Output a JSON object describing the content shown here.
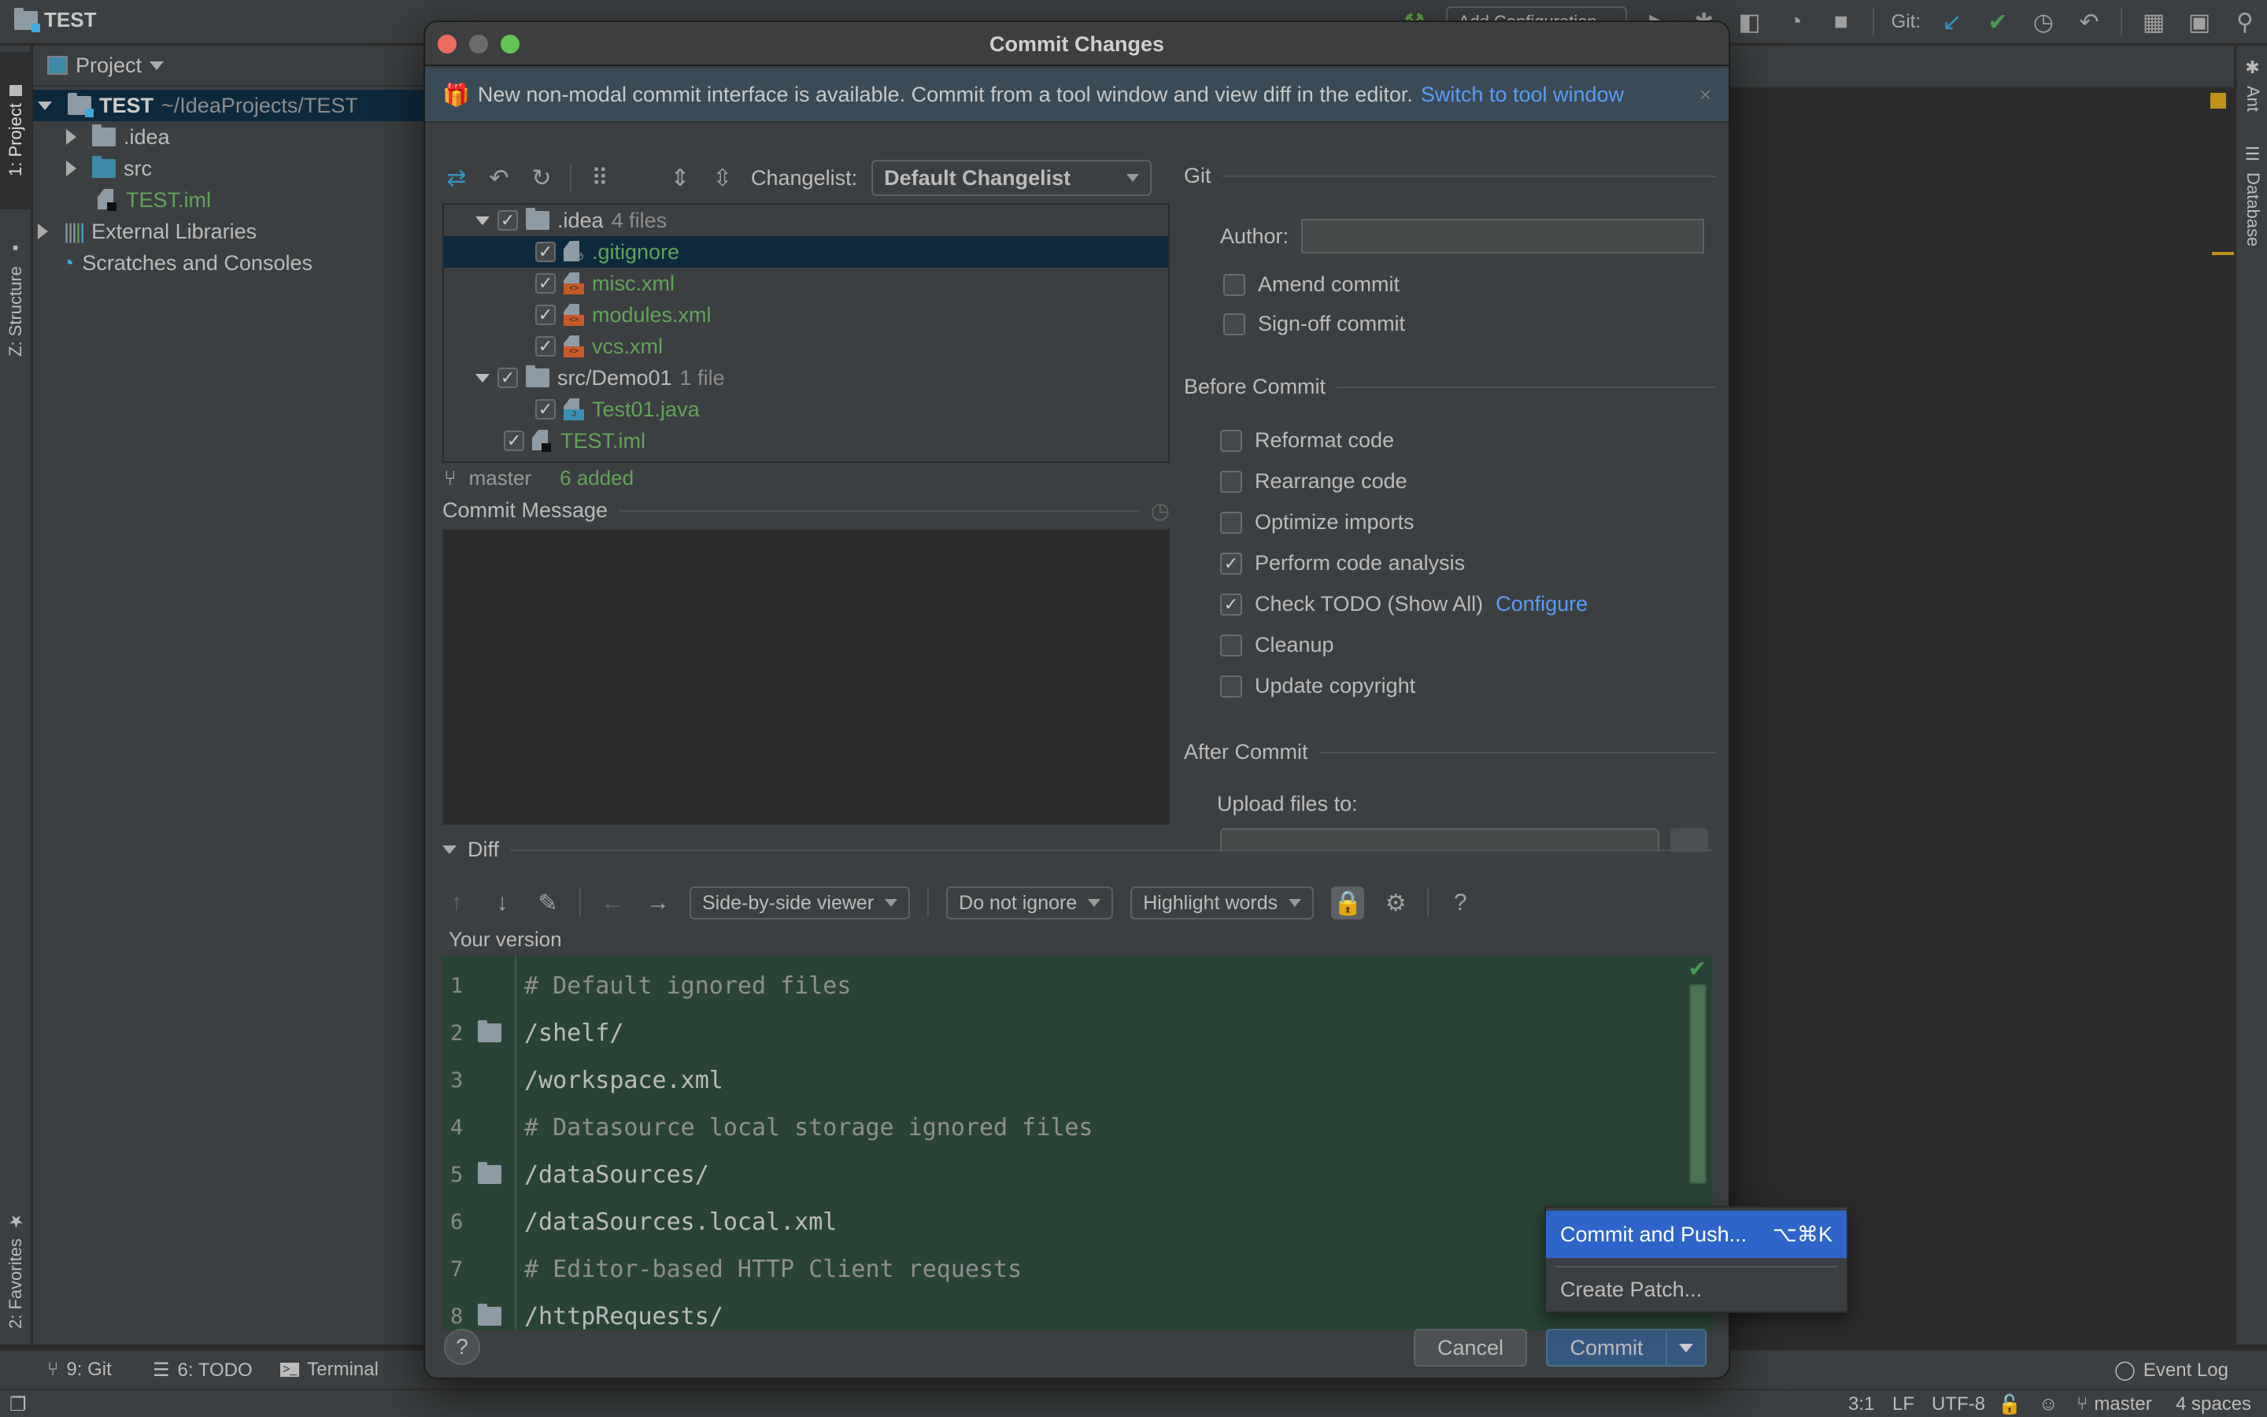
{
  "topbar": {
    "project_name": "TEST",
    "add_configuration": "Add Configuration...",
    "git_label": "Git:"
  },
  "left_strip": {
    "project_tab": "1: Project",
    "structure_tab": "Z: Structure",
    "favorites_tab": "2: Favorites"
  },
  "right_strip": {
    "ant_tab": "Ant",
    "database_tab": "Database"
  },
  "project_panel": {
    "header": "Project",
    "tree": [
      {
        "label": "TEST",
        "hint": "~/IdeaProjects/TEST",
        "level": 0,
        "expanded": true,
        "selected": true,
        "icon": "module-folder-icon"
      },
      {
        "label": ".idea",
        "level": 1,
        "expanded": false,
        "icon": "folder-icon"
      },
      {
        "label": "src",
        "level": 1,
        "expanded": false,
        "icon": "source-folder-icon"
      },
      {
        "label": "TEST.iml",
        "level": 1,
        "icon": "iml-file-icon",
        "status": "added"
      },
      {
        "label": "External Libraries",
        "level": 0,
        "expanded": false,
        "icon": "libraries-icon"
      },
      {
        "label": "Scratches and Consoles",
        "level": 0,
        "icon": "scratches-icon"
      }
    ]
  },
  "dialog": {
    "title": "Commit Changes",
    "notice": {
      "text": "New non-modal commit interface is available. Commit from a tool window and view diff in the editor.",
      "link": "Switch to tool window",
      "close": "×"
    },
    "changelist_label": "Changelist:",
    "changelist_value": "Default Changelist",
    "changes_tree": [
      {
        "label": ".idea",
        "hint": "4 files",
        "level": 0,
        "type": "folder",
        "checked": true,
        "expanded": true
      },
      {
        "label": ".gitignore",
        "level": 1,
        "type": "ignore",
        "checked": true,
        "selected": true
      },
      {
        "label": "misc.xml",
        "level": 1,
        "type": "xml",
        "checked": true
      },
      {
        "label": "modules.xml",
        "level": 1,
        "type": "xml",
        "checked": true
      },
      {
        "label": "vcs.xml",
        "level": 1,
        "type": "xml",
        "checked": true
      },
      {
        "label": "src/Demo01",
        "hint": "1 file",
        "level": 0,
        "type": "folder",
        "checked": true,
        "expanded": true
      },
      {
        "label": "Test01.java",
        "level": 1,
        "type": "java",
        "checked": true
      },
      {
        "label": "TEST.iml",
        "level": 0,
        "type": "iml",
        "checked": true
      }
    ],
    "branch": "master",
    "summary": "6 added",
    "commit_message_label": "Commit Message",
    "commit_message_value": "",
    "git_section": "Git",
    "author_label": "Author:",
    "author_value": "",
    "git_options": [
      {
        "label": "Amend commit",
        "checked": false
      },
      {
        "label": "Sign-off commit",
        "checked": false
      }
    ],
    "before_commit_section": "Before Commit",
    "before_commit_options": [
      {
        "label": "Reformat code",
        "checked": false
      },
      {
        "label": "Rearrange code",
        "checked": false
      },
      {
        "label": "Optimize imports",
        "checked": false
      },
      {
        "label": "Perform code analysis",
        "checked": true
      },
      {
        "label": "Check TODO (Show All)",
        "checked": true,
        "link": "Configure"
      },
      {
        "label": "Cleanup",
        "checked": false
      },
      {
        "label": "Update copyright",
        "checked": false
      }
    ],
    "after_commit_section": "After Commit",
    "upload_label": "Upload files to:",
    "diff": {
      "section": "Diff",
      "viewer": "Side-by-side viewer",
      "ignore": "Do not ignore",
      "highlight": "Highlight words",
      "help": "?",
      "version_label": "Your version",
      "lines": [
        {
          "n": "1",
          "text": "# Default ignored files",
          "comment": true,
          "fold": false
        },
        {
          "n": "2",
          "text": "/shelf/",
          "comment": false,
          "fold": true
        },
        {
          "n": "3",
          "text": "/workspace.xml",
          "comment": false,
          "fold": false
        },
        {
          "n": "4",
          "text": "# Datasource local storage ignored files",
          "comment": true,
          "fold": false
        },
        {
          "n": "5",
          "text": "/dataSources/",
          "comment": false,
          "fold": true
        },
        {
          "n": "6",
          "text": "/dataSources.local.xml",
          "comment": false,
          "fold": false
        },
        {
          "n": "7",
          "text": "# Editor-based HTTP Client requests",
          "comment": true,
          "fold": false
        },
        {
          "n": "8",
          "text": "/httpRequests/",
          "comment": false,
          "fold": true
        }
      ]
    },
    "help_button": "?",
    "cancel_button": "Cancel",
    "commit_button": "Commit",
    "popup": {
      "items": [
        {
          "label": "Commit and Push...",
          "shortcut": "⌥⌘K",
          "highlighted": true
        },
        {
          "label": "Create Patch...",
          "shortcut": "",
          "highlighted": false
        }
      ]
    }
  },
  "bottom_bar": {
    "git": "9: Git",
    "todo": "6: TODO",
    "terminal": "Terminal",
    "event_log": "Event Log"
  },
  "status_bar": {
    "position": "3:1",
    "line_sep": "LF",
    "encoding": "UTF-8",
    "branch": "master",
    "indent": "4 spaces"
  },
  "colors": {
    "accent_link": "#589df6",
    "added_file": "#62a35a",
    "selection": "#0d293e",
    "popup_highlight": "#2f65ca",
    "diff_added_bg": "#294436"
  }
}
